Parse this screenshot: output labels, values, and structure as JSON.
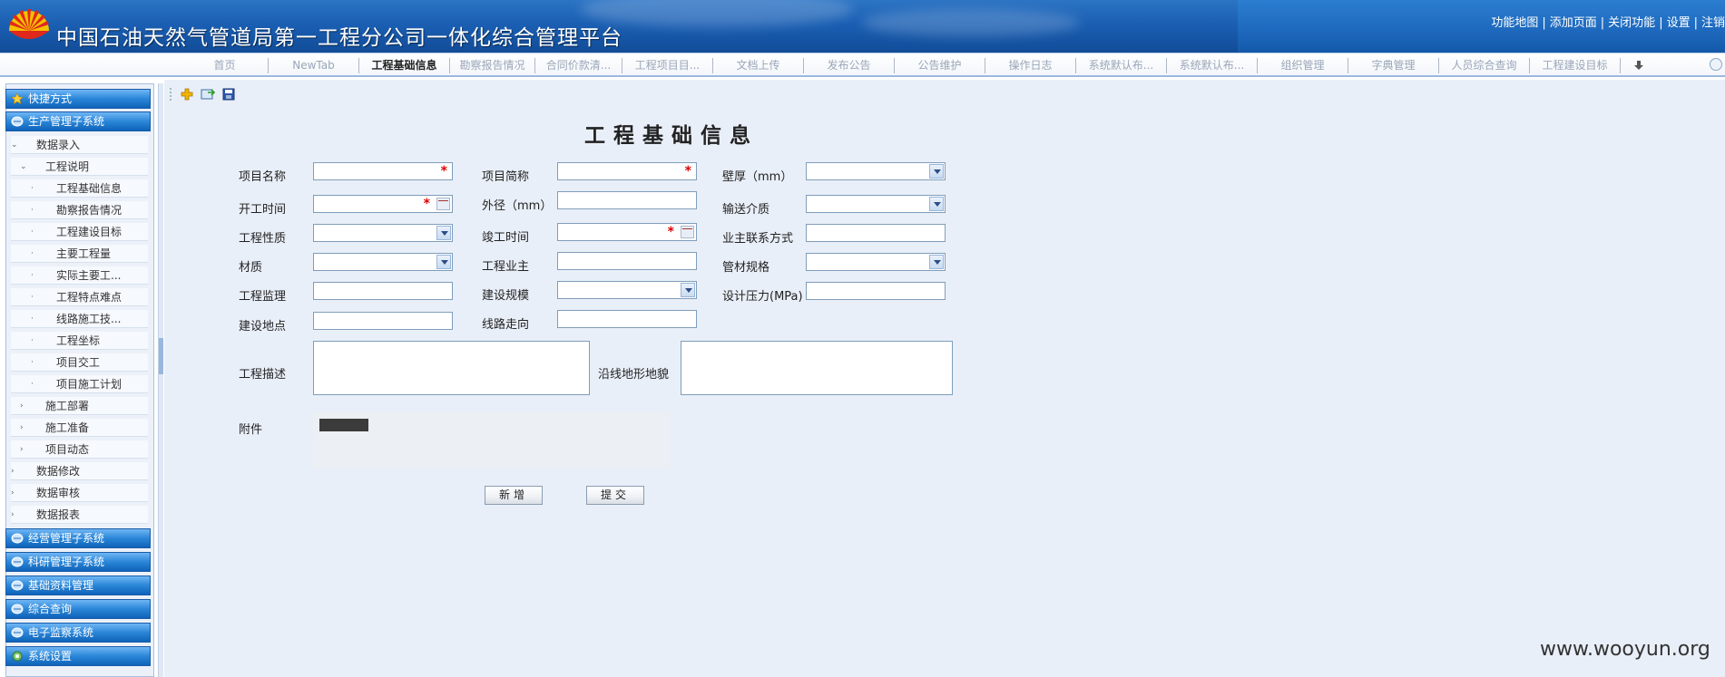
{
  "header": {
    "title": "中国石油天然气管道局第一工程分公司一体化综合管理平台",
    "links": [
      "功能地图",
      "添加页面",
      "关闭功能",
      "设置",
      "注销"
    ],
    "link_separator": "|"
  },
  "tabs": [
    {
      "label": "首页",
      "active": false
    },
    {
      "label": "NewTab",
      "active": false
    },
    {
      "label": "工程基础信息",
      "active": true
    },
    {
      "label": "勘察报告情况",
      "active": false
    },
    {
      "label": "合同价款清...",
      "active": false
    },
    {
      "label": "工程项目目...",
      "active": false
    },
    {
      "label": "文档上传",
      "active": false
    },
    {
      "label": "发布公告",
      "active": false
    },
    {
      "label": "公告维护",
      "active": false
    },
    {
      "label": "操作日志",
      "active": false
    },
    {
      "label": "系统默认布...",
      "active": false
    },
    {
      "label": "系统默认布...",
      "active": false
    },
    {
      "label": "组织管理",
      "active": false
    },
    {
      "label": "字典管理",
      "active": false
    },
    {
      "label": "人员综合查询",
      "active": false
    },
    {
      "label": "工程建设目标",
      "active": false
    }
  ],
  "sidebar": {
    "sections_top": [
      "快捷方式",
      "生产管理子系统"
    ],
    "tree": [
      {
        "label": "数据录入",
        "level": 1,
        "arrow": "expanded"
      },
      {
        "label": "工程说明",
        "level": 2,
        "arrow": "expanded"
      },
      {
        "label": "工程基础信息",
        "level": 3,
        "arrow": "dot"
      },
      {
        "label": "勘察报告情况",
        "level": 3,
        "arrow": "dot"
      },
      {
        "label": "工程建设目标",
        "level": 3,
        "arrow": "dot"
      },
      {
        "label": "主要工程量",
        "level": 3,
        "arrow": "dot"
      },
      {
        "label": "实际主要工...",
        "level": 3,
        "arrow": "dot"
      },
      {
        "label": "工程特点难点",
        "level": 3,
        "arrow": "dot"
      },
      {
        "label": "线路施工技...",
        "level": 3,
        "arrow": "dot"
      },
      {
        "label": "工程坐标",
        "level": 3,
        "arrow": "dot"
      },
      {
        "label": "项目交工",
        "level": 3,
        "arrow": "dot"
      },
      {
        "label": "项目施工计划",
        "level": 3,
        "arrow": "dot"
      },
      {
        "label": "施工部署",
        "level": 2,
        "arrow": "collapsed"
      },
      {
        "label": "施工准备",
        "level": 2,
        "arrow": "collapsed"
      },
      {
        "label": "项目动态",
        "level": 2,
        "arrow": "collapsed"
      },
      {
        "label": "数据修改",
        "level": 1,
        "arrow": "collapsed"
      },
      {
        "label": "数据审核",
        "level": 1,
        "arrow": "collapsed"
      },
      {
        "label": "数据报表",
        "level": 1,
        "arrow": "collapsed"
      }
    ],
    "sections_bottom": [
      "经营管理子系统",
      "科研管理子系统",
      "基础资料管理",
      "综合查询",
      "电子监察系统",
      "系统设置"
    ]
  },
  "form": {
    "title": "工程基础信息",
    "fields": {
      "project_name": "项目名称",
      "project_abbr": "项目简称",
      "wall_thickness": "壁厚（mm）",
      "start_time": "开工时间",
      "outer_diameter": "外径（mm）",
      "medium": "输送介质",
      "nature": "工程性质",
      "finish_time": "竣工时间",
      "owner_contact": "业主联系方式",
      "material": "材质",
      "owner": "工程业主",
      "pipe_spec": "管材规格",
      "supervision": "工程监理",
      "scale": "建设规模",
      "design_pressure": "设计压力(MPa)",
      "site": "建设地点",
      "route": "线路走向",
      "description": "工程描述",
      "terrain": "沿线地形地貌",
      "attachment": "附件"
    },
    "required_mark": "*",
    "buttons": {
      "add": "新增",
      "submit": "提交"
    }
  },
  "watermark": "www.wooyun.org",
  "colors": {
    "header_blue": "#1b5fb3",
    "sidebar_head": "#2a86d8",
    "main_bg": "#e9eff8",
    "required": "#dd0000"
  }
}
